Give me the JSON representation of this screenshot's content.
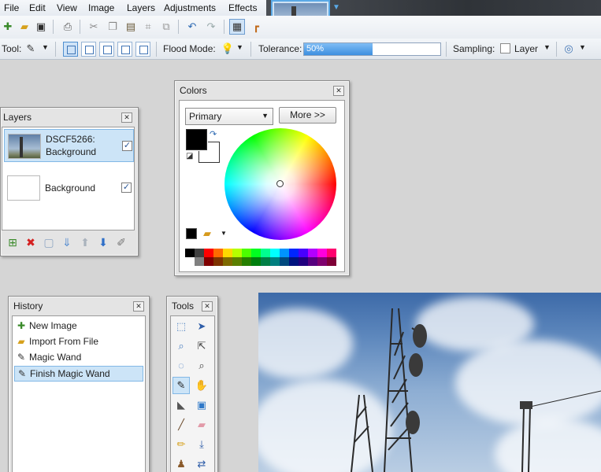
{
  "menu": [
    "File",
    "Edit",
    "View",
    "Image",
    "Layers",
    "Adjustments",
    "Effects"
  ],
  "image_tab": {
    "name": "DSCF5266"
  },
  "toolbar": {
    "tool_label": "Tool:",
    "flood_mode_label": "Flood Mode:",
    "tolerance_label": "Tolerance:",
    "tolerance_value": "50%",
    "tolerance_fraction": 0.5,
    "sampling_label": "Sampling:",
    "sampling_value": "Layer"
  },
  "layers_panel": {
    "title": "Layers",
    "layers": [
      {
        "line1": "DSCF5266:",
        "line2": "Background",
        "visible": true,
        "selected": true
      },
      {
        "line1": "Background",
        "line2": "",
        "visible": true,
        "selected": false
      }
    ]
  },
  "colors_panel": {
    "title": "Colors",
    "mode": "Primary",
    "more_label": "More >>",
    "primary_color": "#000000",
    "secondary_color": "#ffffff",
    "palette_top": [
      "#000000",
      "#404040",
      "#ff0000",
      "#ff6a00",
      "#ffd800",
      "#b6ff00",
      "#4cff00",
      "#00ff21",
      "#00ff90",
      "#00ffff",
      "#0094ff",
      "#0026ff",
      "#4800ff",
      "#b200ff",
      "#ff00dc",
      "#ff006e"
    ],
    "palette_bottom": [
      "#ffffff",
      "#808080",
      "#7f0000",
      "#7f3300",
      "#7f6a00",
      "#5b7f00",
      "#267f00",
      "#007f0e",
      "#007f46",
      "#007f7f",
      "#004a7f",
      "#00137f",
      "#21007f",
      "#57007f",
      "#7f006e",
      "#7f0037"
    ]
  },
  "history_panel": {
    "title": "History",
    "items": [
      {
        "label": "New Image",
        "icon": "new-image-icon",
        "selected": false
      },
      {
        "label": "Import From File",
        "icon": "import-icon",
        "selected": false
      },
      {
        "label": "Magic Wand",
        "icon": "magic-wand-icon",
        "selected": false
      },
      {
        "label": "Finish Magic Wand",
        "icon": "magic-wand-icon",
        "selected": true
      }
    ]
  },
  "tools_panel": {
    "title": "Tools",
    "tools": [
      {
        "name": "rectangle-select-icon",
        "glyph": "⬚"
      },
      {
        "name": "move-selected-pixels-icon",
        "glyph": "➤"
      },
      {
        "name": "lasso-select-icon",
        "glyph": "⌕"
      },
      {
        "name": "move-selection-icon",
        "glyph": "⇱"
      },
      {
        "name": "ellipse-select-icon",
        "glyph": "◌"
      },
      {
        "name": "zoom-icon",
        "glyph": "🔍"
      },
      {
        "name": "magic-wand-icon",
        "glyph": "✎"
      },
      {
        "name": "pan-icon",
        "glyph": "✋"
      },
      {
        "name": "paint-bucket-icon",
        "glyph": "◣"
      },
      {
        "name": "gradient-icon",
        "glyph": "▣"
      },
      {
        "name": "paintbrush-icon",
        "glyph": "╱"
      },
      {
        "name": "eraser-icon",
        "glyph": "▰"
      },
      {
        "name": "pencil-icon",
        "glyph": "✏"
      },
      {
        "name": "color-picker-icon",
        "glyph": "⤓"
      },
      {
        "name": "clone-stamp-icon",
        "glyph": "♟"
      },
      {
        "name": "recolor-icon",
        "glyph": "⇄"
      }
    ]
  }
}
